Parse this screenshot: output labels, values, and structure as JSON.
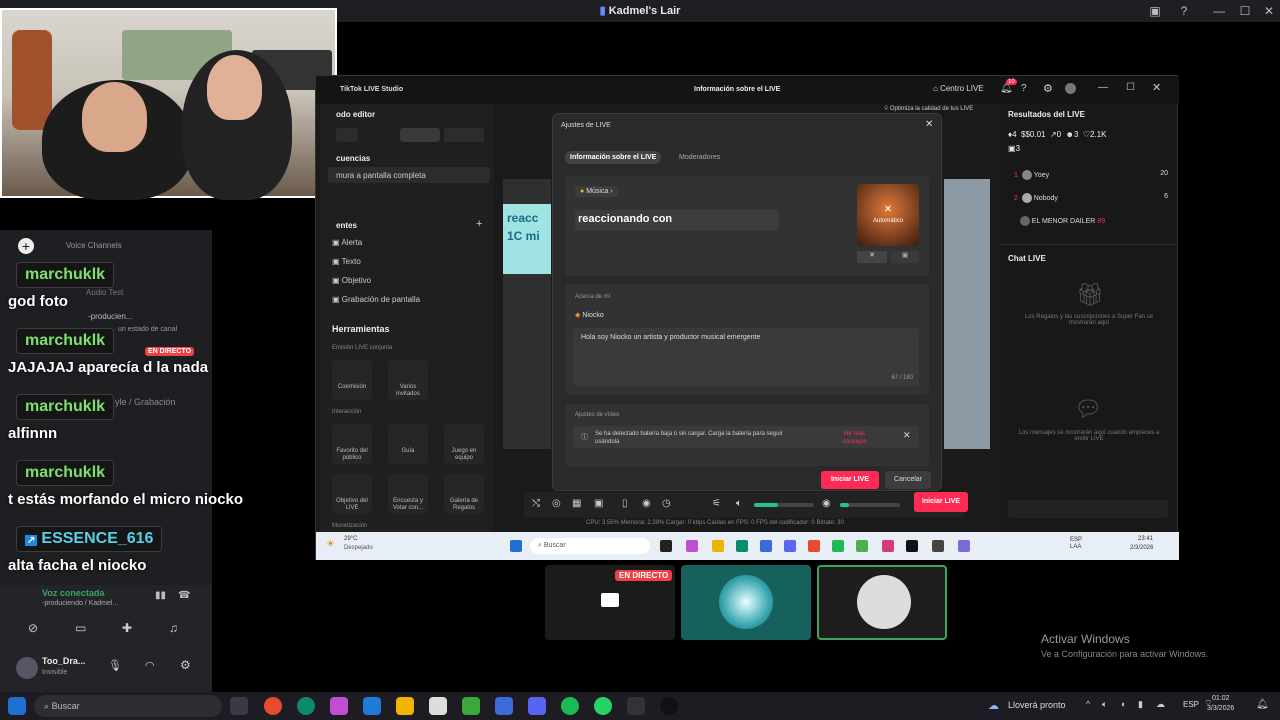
{
  "window_title": "Kadmel's Lair",
  "chat": [
    {
      "name": "marchuklk",
      "text": "god foto"
    },
    {
      "name": "marchuklk",
      "text": "JAJAJAJ aparecía d la nada"
    },
    {
      "name": "marchuklk",
      "text": "alfinnn"
    },
    {
      "name": "marchuklk",
      "text": "t estás morfando el micro niocko"
    },
    {
      "name": "ESSENCE_616",
      "text": "alta facha el niocko"
    }
  ],
  "discord": {
    "voice_channels": "Voice Channels",
    "live_badge": "EN DIRECTO",
    "channel_fragment": "-producien...",
    "status_fragment": "un estado de canal",
    "style_fragment": "yle / Grabación",
    "audio_test": "Audio Test",
    "voice_connected": "Voz conectada",
    "voice_channel": "-produciendo / Kadmel...",
    "user_name": "Too_Dra...",
    "user_status": "Invisible"
  },
  "studio": {
    "app_title": "TikTok LIVE Studio",
    "center_title": "Información sobre el LIVE",
    "live_center": "Centro LIVE",
    "notif_count": "10",
    "quality_tip": "Optimiza la calidad de tus LIVE",
    "mode_label": "odo editor",
    "sequences_label": "cuencias",
    "capture_label": "mura a pantalla completa",
    "sources_label": "entes",
    "sources": [
      "Alerta",
      "Texto",
      "Objetivo",
      "Grabación de pantalla"
    ],
    "tools_label": "Herramientas",
    "joint_emission": "Emisión LIVE conjunta",
    "tools_row1": [
      "Coemisión",
      "Varios invitados"
    ],
    "interaction_label": "Interacción",
    "tools_row2": [
      "Favorito del público",
      "Guía",
      "Juego en equipo"
    ],
    "tools_row3": [
      "Objetivo del LIVE",
      "Encuesta y Votar con...",
      "Galería de Regalos"
    ],
    "monetization_label": "Monetización",
    "preview_text_a": "reacc",
    "preview_text_b": "1C mi",
    "status_bar": "CPU: 3.55%   Memoria: 2.38%   Cargar: 0 kbps   Caídas en FPS: 0   FPS del codificador: 0   Bitrate: 30",
    "start_live_btn": "Iniciar LIVE"
  },
  "results": {
    "title": "Resultados del LIVE",
    "stats": [
      "4",
      "$0.01",
      "0",
      "3",
      "2.1K"
    ],
    "viewers": "3",
    "ranking": [
      {
        "rank": "1",
        "name": "Yoey",
        "score": "20"
      },
      {
        "rank": "2",
        "name": "Nobody",
        "score": "6"
      },
      {
        "rank": "",
        "name": "EL MENOR DAILER",
        "score": "89"
      }
    ],
    "chat_title": "Chat LIVE",
    "gifts_note": "Los Regalos y las suscripciones a Super Fan se mostrarán aquí",
    "messages_note": "Los mensajes se mostrarán aquí cuando empieces a emitir LIVE"
  },
  "modal": {
    "title": "Ajustes de LIVE",
    "tab_info": "Información sobre el LIVE",
    "tab_mods": "Moderadores",
    "music_chip": "Música",
    "live_title": "reaccionando con",
    "cover_label": "Automático",
    "about_label": "Acerca de mí",
    "host_name": "Niocko",
    "bio": "Hola soy Niocko un artista y productor musical emergente",
    "char_count": "67 / 180",
    "video_settings": "Ajustes de vídeo",
    "battery_warning": "Se ha detectado batería baja o sin cargar. Carga la batería para seguir usándola",
    "warning_link": "Ver más consejos",
    "start_btn": "Iniciar LIVE",
    "cancel_btn": "Cancelar"
  },
  "studio_taskbar": {
    "weather_temp": "29°C",
    "weather_desc": "Despejado",
    "search": "Buscar",
    "lang": "ESP\nLAA",
    "time": "23:41",
    "date": "2/3/2026"
  },
  "thumbnails": {
    "live_badge": "EN DIRECTO"
  },
  "activate": {
    "title": "Activar Windows",
    "subtitle": "Ve a Configuración para activar Windows."
  },
  "taskbar": {
    "search": "Buscar",
    "weather": "Lloverá pronto",
    "lang": "ESP",
    "time": "01:02",
    "date": "3/3/2026"
  },
  "colors": {
    "accent": "#fe2c55",
    "chat_name": "#7de26b",
    "voice_green": "#3ba55d"
  }
}
